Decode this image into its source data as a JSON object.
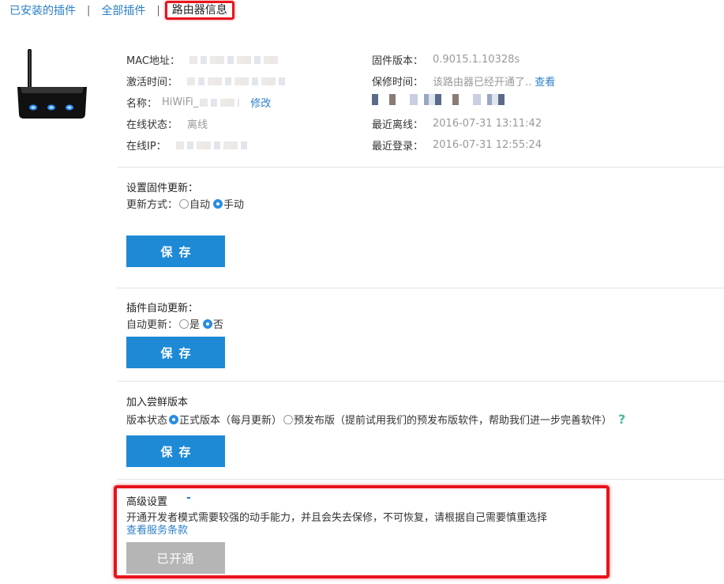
{
  "tabs": {
    "installed": "已安装的插件",
    "all": "全部插件",
    "router_info": "路由器信息",
    "separator": "|"
  },
  "device": {
    "mac_label": "MAC地址：",
    "activation_label": "激活时间：",
    "name_label": "名称：",
    "name_value": "HiWiFi_",
    "name_edit": "修改",
    "status_label": "在线状态：",
    "status_value": "离线",
    "ip_label": "在线IP：",
    "firmware_label": "固件版本：",
    "firmware_value": "0.9015.1.10328s",
    "warranty_label": "保修时间：",
    "warranty_value": "该路由器已经开通了..",
    "warranty_link": "查看",
    "last_offline_label": "最近离线：",
    "last_offline_value": "2016-07-31 13:11:42",
    "last_login_label": "最近登录：",
    "last_login_value": "2016-07-31 12:55:24"
  },
  "firmware_update": {
    "title": "设置固件更新：",
    "mode_label": "更新方式：",
    "opt_auto": "自动",
    "opt_manual": "手动",
    "selected": "手动",
    "save": "保存"
  },
  "plugin_update": {
    "title": "插件自动更新：",
    "mode_label": "自动更新：",
    "opt_yes": "是",
    "opt_no": "否",
    "selected": "否",
    "save": "保存"
  },
  "beta": {
    "title": "加入尝鲜版本",
    "status_label": "版本状态",
    "opt_stable": "正式版本（每月更新）",
    "opt_beta": "预发布版（提前试用我们的预发布版软件，帮助我们进一步完善软件）",
    "selected": "正式版本（每月更新）",
    "help": "?",
    "save": "保存"
  },
  "advanced": {
    "title": "高级设置",
    "toggle": "-",
    "description": "开通开发者模式需要较强的动手能力，并且会失去保修，不可恢复，请根据自己需要慎重选择",
    "terms_link": "查看服务条款",
    "status_button": "已开通"
  },
  "colors": {
    "accent": "#1e8ad6",
    "link": "#2a7fc9",
    "highlight": "#e8141c",
    "disabled": "#b5b5b5"
  }
}
